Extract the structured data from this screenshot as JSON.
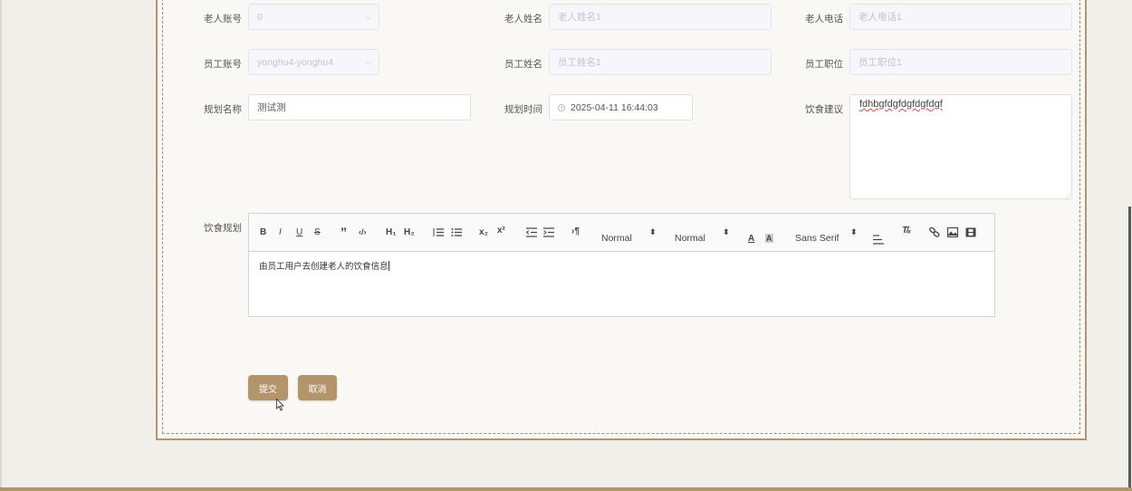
{
  "form": {
    "elder_account": {
      "label": "老人账号",
      "value": "0"
    },
    "elder_name": {
      "label": "老人姓名",
      "placeholder": "老人姓名1"
    },
    "elder_phone": {
      "label": "老人电话",
      "placeholder": "老人电话1"
    },
    "staff_account": {
      "label": "员工账号",
      "value": "yonghu4-yonghu4"
    },
    "staff_name": {
      "label": "员工姓名",
      "placeholder": "员工姓名1"
    },
    "staff_position": {
      "label": "员工职位",
      "placeholder": "员工职位1"
    },
    "plan_name": {
      "label": "规划名称",
      "value": "测试测"
    },
    "plan_time": {
      "label": "规划时间",
      "value": "2025-04-11 16:44:03"
    },
    "diet_advice": {
      "label": "饮食建议",
      "value": "fdhbgfdgfdgfdgfdgf"
    },
    "diet_plan": {
      "label": "饮食规划",
      "content": "由员工用户去创建老人的饮食信息"
    }
  },
  "editor_toolbar": {
    "bold": "B",
    "italic": "I",
    "underline": "U",
    "strike": "S",
    "blockquote": "”",
    "code": "‹/›",
    "h1": "H₁",
    "h2": "H₂",
    "subscript": "x₂",
    "superscript": "x²",
    "direction": "›¶",
    "size_select": "Normal",
    "header_select": "Normal",
    "font_select": "Sans Serif",
    "color": "A",
    "background": "A",
    "clean": "T̸ₓ"
  },
  "buttons": {
    "submit": "提交",
    "cancel": "取消"
  },
  "colors": {
    "accent": "#b2956a",
    "background": "#f0efea"
  }
}
